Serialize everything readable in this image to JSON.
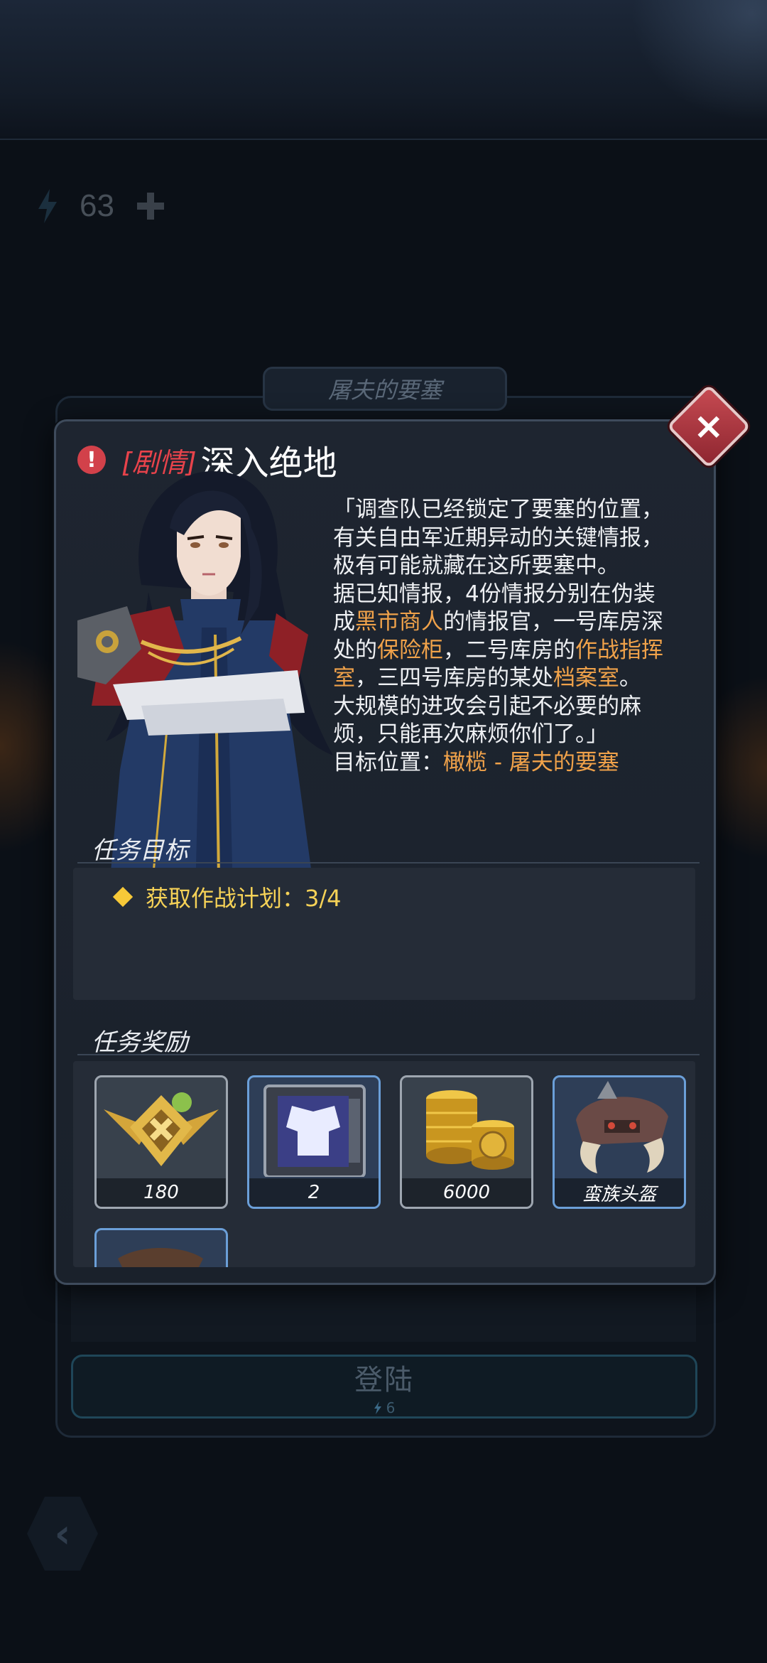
{
  "background": {
    "energy_count": "63",
    "stage_title": "屠夫的要塞"
  },
  "modal": {
    "title_tag": "[剧情]",
    "title": "深入绝地",
    "story_lines": [
      [
        {
          "t": "「调查队已经锁定了要塞的位置，"
        }
      ],
      [
        {
          "t": "有关自由军近期异动的关键情报，"
        }
      ],
      [
        {
          "t": "极有可能就藏在这所要塞中。"
        }
      ],
      [
        {
          "t": "据已知情报，4份情报分别在伪装"
        }
      ],
      [
        {
          "t": "成"
        },
        {
          "t": "黑市商人",
          "hl": true
        },
        {
          "t": "的情报官，一号库房深"
        }
      ],
      [
        {
          "t": "处的"
        },
        {
          "t": "保险柜",
          "hl": true
        },
        {
          "t": "，二号库房的"
        },
        {
          "t": "作战指挥",
          "hl": true
        }
      ],
      [
        {
          "t": "室",
          "hl": true
        },
        {
          "t": "，三四号库房的某处"
        },
        {
          "t": "档案室",
          "hl": true
        },
        {
          "t": "。"
        }
      ],
      [
        {
          "t": "大规模的进攻会引起不必要的麻"
        }
      ],
      [
        {
          "t": "烦，只能再次麻烦你们了。」"
        }
      ],
      [
        {
          "t": "目标位置："
        },
        {
          "t": "橄榄 - 屠夫的要塞",
          "hl": true
        }
      ]
    ],
    "objective_header": "任务目标",
    "objectives": [
      {
        "label": "获取作战计划：3/4"
      }
    ],
    "rewards_header": "任务奖励",
    "rewards": [
      {
        "qty": "180",
        "icon": "gold-badge-icon",
        "frame": "grey"
      },
      {
        "qty": "2",
        "icon": "armor-crate-icon",
        "frame": "blue"
      },
      {
        "qty": "6000",
        "icon": "gold-coins-icon",
        "frame": "grey"
      },
      {
        "qty": "蛮族头盔",
        "icon": "barbarian-helmet-icon",
        "frame": "blue"
      },
      {
        "qty": "",
        "icon": "partial-item-icon",
        "frame": "blue"
      }
    ]
  },
  "login_button": {
    "label": "登陆",
    "cost": "6"
  },
  "colors": {
    "highlight": "#f0a24a",
    "tag_red": "#e8434b",
    "objective_yellow": "#f6d257"
  }
}
